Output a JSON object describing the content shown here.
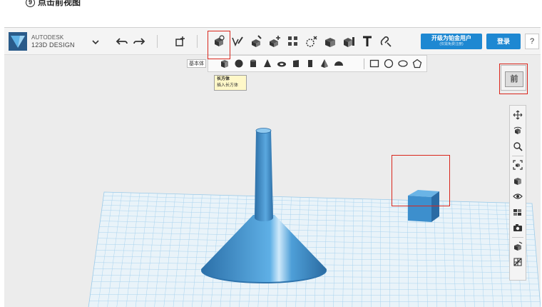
{
  "caption": {
    "number": "9",
    "text": "点击前视图"
  },
  "app": {
    "brand_line1": "AUTODESK",
    "brand_line2": "123D DESIGN",
    "upgrade_line1": "开级为铂金用户",
    "upgrade_line2": "(仅需免费注册)",
    "login_label": "登录",
    "help_label": "?"
  },
  "submenu": {
    "group_label": "基本体"
  },
  "tooltip": {
    "title": "长方体",
    "description": "插入长方体"
  },
  "viewcube": {
    "face_label": "前"
  },
  "colors": {
    "accent": "#1e88d2",
    "highlight": "#d9261c",
    "model": "#3d8fcd",
    "grid": "#8ec5e8"
  }
}
